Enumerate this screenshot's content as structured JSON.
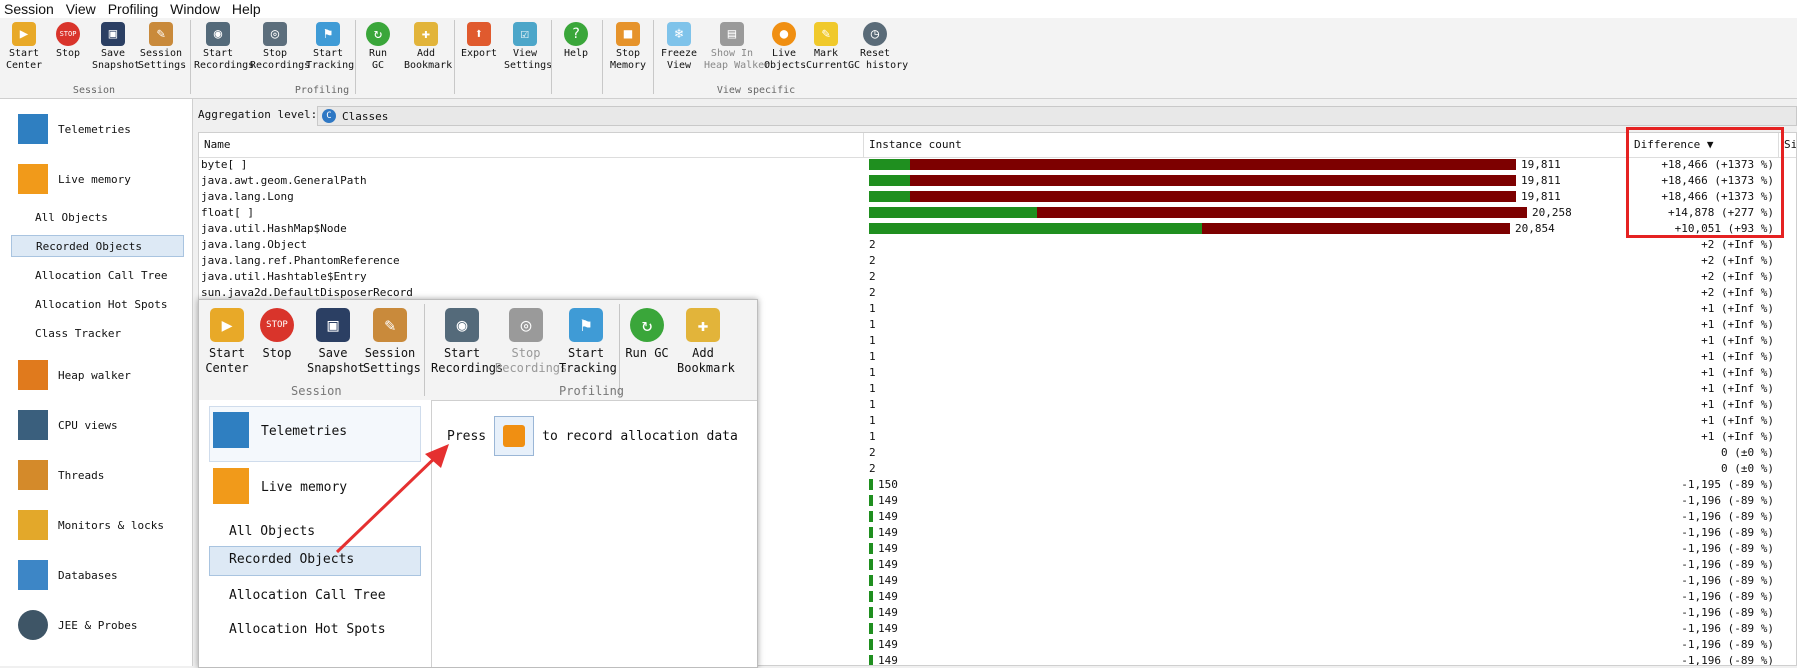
{
  "menu": [
    "Session",
    "View",
    "Profiling",
    "Window",
    "Help"
  ],
  "toolbar": {
    "groups": [
      {
        "label": "Session",
        "buttons": [
          {
            "label": "Start\nCenter",
            "icon": "start-center-icon"
          },
          {
            "label": "Stop",
            "icon": "stop-icon"
          },
          {
            "label": "Save\nSnapshot",
            "icon": "save-icon"
          },
          {
            "label": "Session\nSettings",
            "icon": "settings-icon"
          }
        ]
      },
      {
        "label": "Profiling",
        "buttons": [
          {
            "label": "Start\nRecordings",
            "icon": "start-recordings-icon"
          },
          {
            "label": "Stop\nRecordings",
            "icon": "stop-recordings-icon"
          },
          {
            "label": "Start\nTracking",
            "icon": "start-tracking-icon"
          },
          {
            "label": "Run GC",
            "icon": "run-gc-icon"
          },
          {
            "label": "Add\nBookmark",
            "icon": "bookmark-icon"
          }
        ]
      },
      {
        "label": "",
        "buttons": [
          {
            "label": "Export",
            "icon": "export-icon"
          },
          {
            "label": "View\nSettings",
            "icon": "view-settings-icon"
          },
          {
            "label": "Help",
            "icon": "help-icon"
          }
        ]
      },
      {
        "label": "View specific",
        "buttons": [
          {
            "label": "Stop\nMemory",
            "icon": "stop-memory-icon"
          },
          {
            "label": "Freeze\nView",
            "icon": "freeze-icon"
          },
          {
            "label": "Show In\nHeap Walker",
            "icon": "heap-walker-icon"
          },
          {
            "label": "Live\nObjects",
            "icon": "live-objects-icon"
          },
          {
            "label": "Mark\nCurrent",
            "icon": "mark-current-icon"
          },
          {
            "label": "Reset\nGC history",
            "icon": "reset-icon"
          }
        ]
      }
    ]
  },
  "sidebar": {
    "items": [
      {
        "label": "Telemetries",
        "icon": "telemetries-icon"
      },
      {
        "label": "Live memory",
        "icon": "live-memory-icon"
      },
      {
        "label": "Heap walker",
        "icon": "heap-walker-icon"
      },
      {
        "label": "CPU views",
        "icon": "cpu-views-icon"
      },
      {
        "label": "Threads",
        "icon": "threads-icon"
      },
      {
        "label": "Monitors & locks",
        "icon": "monitors-locks-icon"
      },
      {
        "label": "Databases",
        "icon": "databases-icon"
      },
      {
        "label": "JEE & Probes",
        "icon": "jee-probes-icon"
      }
    ],
    "subitems": [
      "All Objects",
      "Recorded Objects",
      "Allocation Call Tree",
      "Allocation Hot Spots",
      "Class Tracker"
    ],
    "selected": "Recorded Objects"
  },
  "aggregation": {
    "label": "Aggregation level:",
    "value": "Classes"
  },
  "table": {
    "headers": [
      "Name",
      "Instance count",
      "Difference ▼",
      "Si"
    ],
    "rows": [
      {
        "name": "byte[ ]",
        "count": "19,811",
        "diff": "+18,466 (+1373 %)",
        "green": 0.058,
        "red": 0.865
      },
      {
        "name": "java.awt.geom.GeneralPath",
        "count": "19,811",
        "diff": "+18,466 (+1373 %)",
        "green": 0.058,
        "red": 0.865
      },
      {
        "name": "java.lang.Long",
        "count": "19,811",
        "diff": "+18,466 (+1373 %)",
        "green": 0.058,
        "red": 0.865
      },
      {
        "name": "float[ ]",
        "count": "20,258",
        "diff": "+14,878 (+277 %)",
        "green": 0.24,
        "red": 0.7
      },
      {
        "name": "java.util.HashMap$Node",
        "count": "20,854",
        "diff": "+10,051 (+93 %)",
        "green": 0.475,
        "red": 0.44
      },
      {
        "name": "java.lang.Object",
        "count": "2",
        "diff": "+2 (+Inf %)",
        "green": 0,
        "red": 0
      },
      {
        "name": "java.lang.ref.PhantomReference",
        "count": "2",
        "diff": "+2 (+Inf %)",
        "green": 0,
        "red": 0
      },
      {
        "name": "java.util.Hashtable$Entry",
        "count": "2",
        "diff": "+2 (+Inf %)",
        "green": 0,
        "red": 0
      },
      {
        "name": "sun.java2d.DefaultDisposerRecord",
        "count": "2",
        "diff": "+2 (+Inf %)",
        "green": 0,
        "red": 0
      },
      {
        "name": "",
        "count": "1",
        "diff": "+1 (+Inf %)",
        "green": 0,
        "red": 0
      },
      {
        "name": "",
        "count": "1",
        "diff": "+1 (+Inf %)",
        "green": 0,
        "red": 0
      },
      {
        "name": "",
        "count": "1",
        "diff": "+1 (+Inf %)",
        "green": 0,
        "red": 0
      },
      {
        "name": "",
        "count": "1",
        "diff": "+1 (+Inf %)",
        "green": 0,
        "red": 0
      },
      {
        "name": "",
        "count": "1",
        "diff": "+1 (+Inf %)",
        "green": 0,
        "red": 0
      },
      {
        "name": "",
        "count": "1",
        "diff": "+1 (+Inf %)",
        "green": 0,
        "red": 0
      },
      {
        "name": "",
        "count": "1",
        "diff": "+1 (+Inf %)",
        "green": 0,
        "red": 0
      },
      {
        "name": "",
        "count": "1",
        "diff": "+1 (+Inf %)",
        "green": 0,
        "red": 0
      },
      {
        "name": "",
        "count": "1",
        "diff": "+1 (+Inf %)",
        "green": 0,
        "red": 0
      },
      {
        "name": "",
        "count": "2",
        "diff": "0 (±0 %)",
        "green": 0,
        "red": 0
      },
      {
        "name": "",
        "count": "2",
        "diff": "0 (±0 %)",
        "green": 0,
        "red": 0
      },
      {
        "name": "",
        "count": "150",
        "diff": "-1,195 (-89 %)",
        "green": 0.006,
        "red": 0
      },
      {
        "name": "",
        "count": "149",
        "diff": "-1,196 (-89 %)",
        "green": 0.006,
        "red": 0
      },
      {
        "name": "",
        "count": "149",
        "diff": "-1,196 (-89 %)",
        "green": 0.006,
        "red": 0
      },
      {
        "name": "",
        "count": "149",
        "diff": "-1,196 (-89 %)",
        "green": 0.006,
        "red": 0
      },
      {
        "name": "",
        "count": "149",
        "diff": "-1,196 (-89 %)",
        "green": 0.006,
        "red": 0
      },
      {
        "name": "",
        "count": "149",
        "diff": "-1,196 (-89 %)",
        "green": 0.006,
        "red": 0
      },
      {
        "name": "",
        "count": "149",
        "diff": "-1,196 (-89 %)",
        "green": 0.006,
        "red": 0
      },
      {
        "name": "",
        "count": "149",
        "diff": "-1,196 (-89 %)",
        "green": 0.006,
        "red": 0
      },
      {
        "name": "",
        "count": "149",
        "diff": "-1,196 (-89 %)",
        "green": 0.006,
        "red": 0
      },
      {
        "name": "",
        "count": "149",
        "diff": "-1,196 (-89 %)",
        "green": 0.006,
        "red": 0
      },
      {
        "name": "",
        "count": "149",
        "diff": "-1,196 (-89 %)",
        "green": 0.006,
        "red": 0
      },
      {
        "name": "",
        "count": "149",
        "diff": "-1,196 (-89 %)",
        "green": 0.006,
        "red": 0
      }
    ]
  },
  "overlay": {
    "buttons": [
      {
        "label": "Start\nCenter",
        "icon": "start-center-icon"
      },
      {
        "label": "Stop",
        "icon": "stop-icon"
      },
      {
        "label": "Save\nSnapshot",
        "icon": "save-icon"
      },
      {
        "label": "Session\nSettings",
        "icon": "settings-icon"
      },
      {
        "label": "Start\nRecordings",
        "icon": "start-recordings-icon"
      },
      {
        "label": "Stop\nRecordings",
        "icon": "stop-recordings-icon"
      },
      {
        "label": "Start\nTracking",
        "icon": "start-tracking-icon"
      },
      {
        "label": "Run GC",
        "icon": "run-gc-icon"
      },
      {
        "label": "Add\nBookmark",
        "icon": "bookmark-icon"
      }
    ],
    "group_labels": [
      "Session",
      "Profiling"
    ],
    "side_items": [
      "Telemetries",
      "Live memory",
      "All Objects",
      "Recorded Objects",
      "Allocation Call Tree",
      "Allocation Hot Spots"
    ],
    "press": "Press",
    "message": "to record allocation data"
  },
  "colors": {
    "green": "#1f8f1f",
    "red": "#7d0000",
    "highlight": "#e52222",
    "arrow": "#e53030"
  }
}
